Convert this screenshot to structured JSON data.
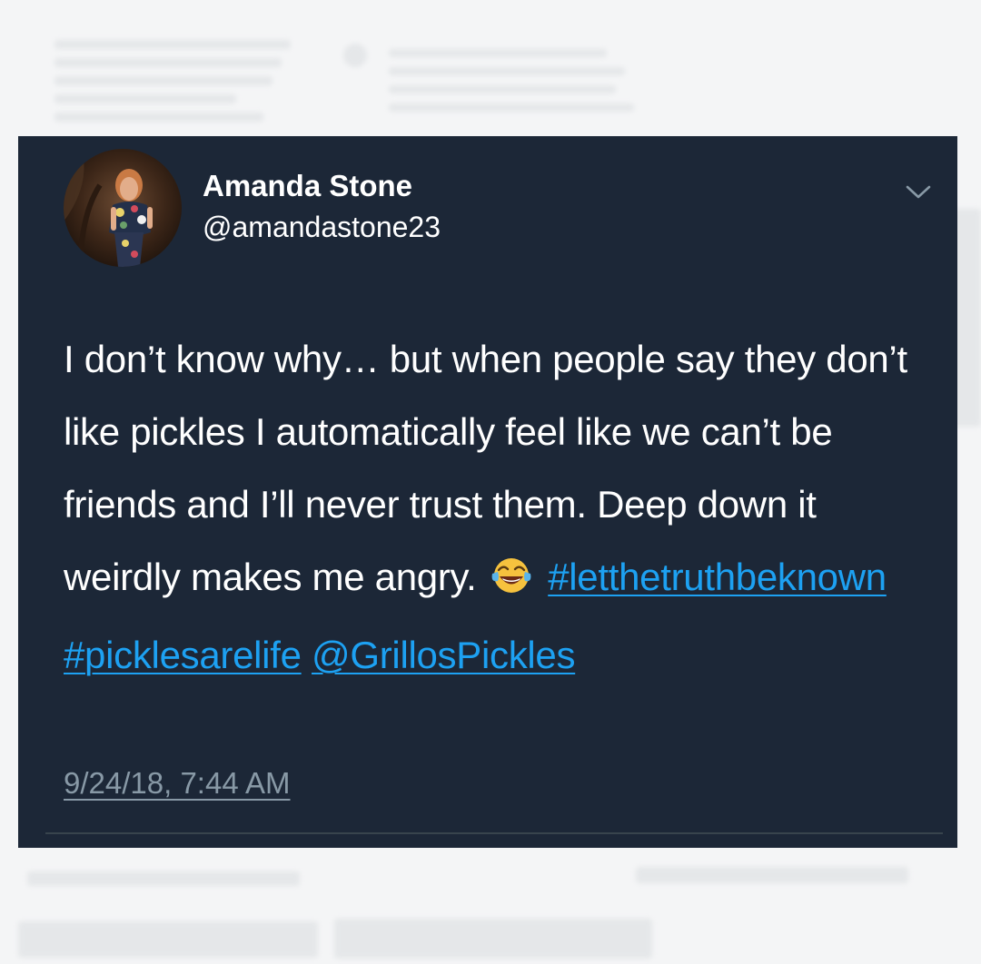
{
  "tweet": {
    "author_name": "Amanda Stone",
    "author_handle": "@amandastone23",
    "text_part": "I don’t know why… but when people say they don’t like pickles I automatically feel like we can’t be friends and I’ll never trust them. Deep down it weirdly makes me angry.",
    "emoji": "face-with-tears-of-joy",
    "hashtag_1": "#letthetruthbeknown",
    "hashtag_2": "#picklesarelife",
    "mention": "@GrillosPickles",
    "timestamp": "9/24/18, 7:44 AM"
  },
  "colors": {
    "card_background": "#1c2737",
    "text": "#ffffff",
    "link": "#1da1f2",
    "secondary_text": "#8899a6",
    "divider": "#38444d",
    "page_background": "#f4f5f6"
  },
  "icons": {
    "menu": "chevron-down-icon",
    "avatar": "profile-photo"
  }
}
